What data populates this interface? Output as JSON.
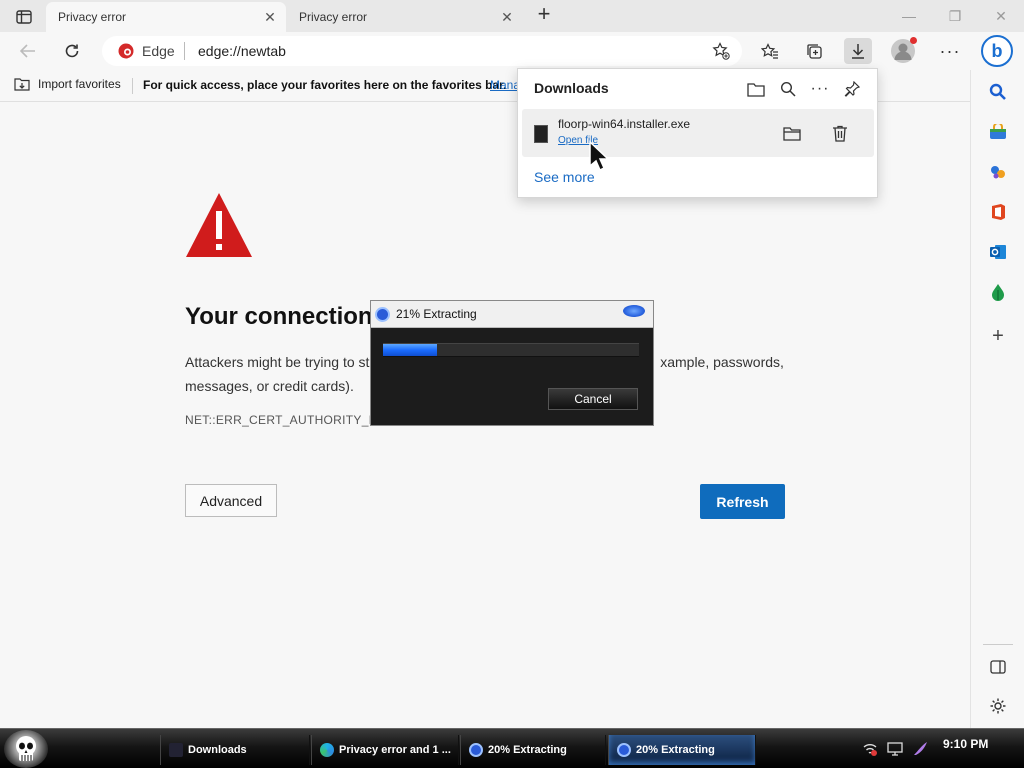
{
  "browser": {
    "tabs": [
      {
        "label": "Privacy error",
        "active": true
      },
      {
        "label": "Privacy error",
        "active": false
      }
    ],
    "address": {
      "brand": "Edge",
      "url": "edge://newtab"
    },
    "icons": {
      "tab_actions": "tab-actions-icon",
      "new_tab": "plus-icon",
      "back": "back-arrow-icon",
      "refresh": "refresh-icon",
      "add_favorite": "star-plus-icon",
      "favorites": "favorites-icon",
      "collections": "collections-icon",
      "downloads": "download-icon",
      "profile": "profile-icon",
      "more": "more-icon",
      "bing": "bing-icon"
    }
  },
  "favorites_bar": {
    "import_label": "Import favorites",
    "message": "For quick access, place your favorites here on the favorites bar.",
    "manage_link": "Mana"
  },
  "page": {
    "heading": "Your connection",
    "description_left": "Attackers might be trying to ste",
    "description_right": "xample, passwords,",
    "description_line2": "messages, or credit cards).",
    "error_code": "NET::ERR_CERT_AUTHORITY_IN",
    "advanced_label": "Advanced",
    "refresh_label": "Refresh",
    "accent_color": "#0f6cbd",
    "warning_color": "#d01c1c"
  },
  "downloads_panel": {
    "title": "Downloads",
    "items": [
      {
        "filename": "floorp-win64.installer.exe",
        "action": "Open file"
      }
    ],
    "see_more": "See more"
  },
  "extract_dialog": {
    "title": "21% Extracting",
    "progress": 0.21,
    "cancel_label": "Cancel"
  },
  "taskbar": {
    "tasks": [
      {
        "label": "Downloads",
        "active": false
      },
      {
        "label": "Privacy error and 1 ...",
        "active": false
      },
      {
        "label": "20% Extracting",
        "active": false
      },
      {
        "label": "20% Extracting",
        "active": true
      }
    ],
    "clock": "9:10 PM"
  }
}
